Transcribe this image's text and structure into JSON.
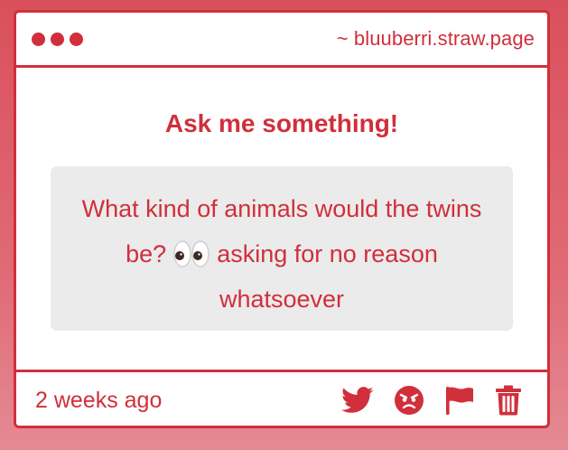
{
  "window": {
    "site_url": "~ bluuberri.straw.page",
    "dots": [
      "dot",
      "dot",
      "dot"
    ]
  },
  "main": {
    "heading": "Ask me something!",
    "question": {
      "text_before": "What kind of animals would the twins be?",
      "emoji_icon": "eyes-emoji",
      "text_after": "asking for no reason whatsoever"
    }
  },
  "footer": {
    "timestamp": "2 weeks ago",
    "actions": [
      {
        "icon": "twitter-icon"
      },
      {
        "icon": "angry-face-icon"
      },
      {
        "icon": "flag-icon"
      },
      {
        "icon": "trash-icon"
      }
    ]
  },
  "colors": {
    "accent": "#d02f3b",
    "background_top": "#d9505c",
    "background_bottom": "#e48a93",
    "question_box": "#ebebeb",
    "window": "#ffffff"
  }
}
